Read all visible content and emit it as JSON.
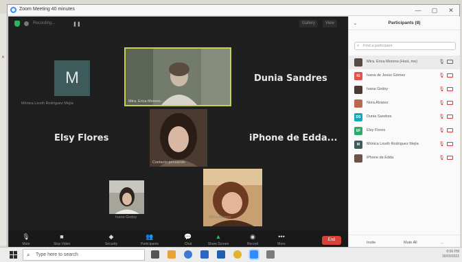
{
  "window": {
    "title": "Zoom Meeting 40 minutes",
    "minimize": "—",
    "maximize": "▢",
    "close": "✕"
  },
  "topbar": {
    "recording_label": "Recording...",
    "pause_icon": "❚❚",
    "gallery_view": "Gallery",
    "view_label": "View"
  },
  "tiles": {
    "m_avatar_letter": "M",
    "m_label": "Mónica Liceth Rodríguez Mejía",
    "erica_label": "Mtra. Erica Moreno...",
    "dunia_name": "Dunia Sandres",
    "elsy_name": "Elsy Flores",
    "iphone_name": "iPhone de Edda...",
    "center_label": "Contacto pensando",
    "ivana_label": "Ivana Godoy",
    "nora_label": "Nora Alvarez"
  },
  "toolbar": {
    "mute": "Mute",
    "stop_video": "Stop Video",
    "security": "Security",
    "participants": "Participants",
    "chat": "Chat",
    "share_screen": "Share Screen",
    "record": "Record",
    "more": "More",
    "end": "End"
  },
  "panel": {
    "title": "Participants (8)",
    "search_placeholder": "Find a participant",
    "participants": [
      {
        "initials": "",
        "name": "Mtra. Erica Moreno (Host, me)",
        "color": "#5a4a44"
      },
      {
        "initials": "IG",
        "name": "Ivana de Jesús Gómez",
        "color": "#e0524b"
      },
      {
        "initials": "",
        "name": "Ivana Godoy",
        "color": "#4a3a33"
      },
      {
        "initials": "",
        "name": "Nora Alvarez",
        "color": "#b86a4f"
      },
      {
        "initials": "DS",
        "name": "Dunia Sandres",
        "color": "#16a8b6"
      },
      {
        "initials": "EF",
        "name": "Elsy Flores",
        "color": "#2eaa6a"
      },
      {
        "initials": "M",
        "name": "Mónica Liceth Rodríguez Mejía",
        "color": "#3c5b5a"
      },
      {
        "initials": "",
        "name": "iPhone de Edda",
        "color": "#6d5446"
      }
    ],
    "invite": "Invite",
    "mute_all": "Mute All",
    "more": "..."
  },
  "taskbar": {
    "search_text": "Type here to search",
    "time": "6:06 PM",
    "date": "30/03/2022"
  },
  "colors": {
    "meeting_bg": "#1f1f1f",
    "active_speaker": "#c9d04a",
    "end_red": "#d6423a"
  }
}
